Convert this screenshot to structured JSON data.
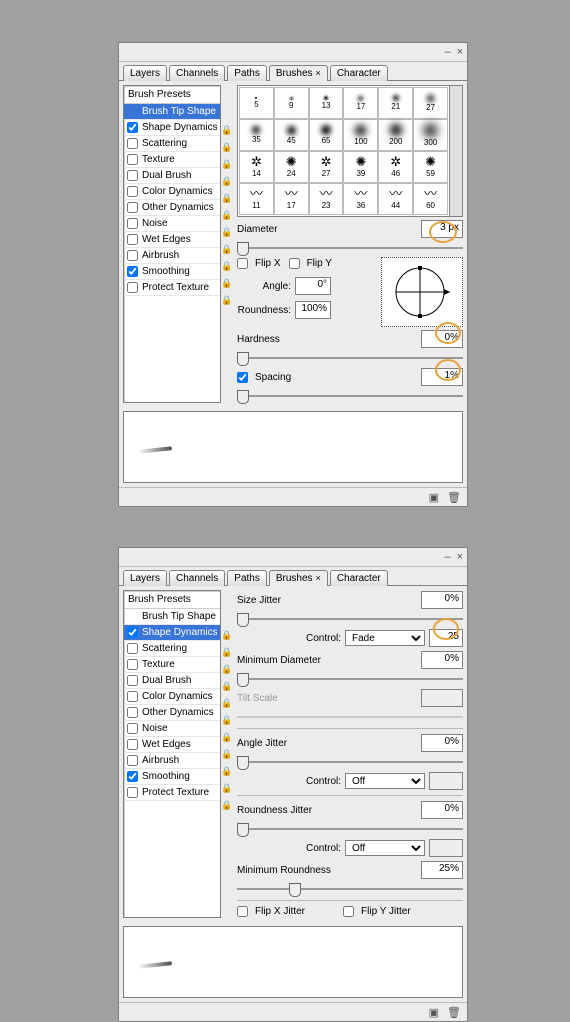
{
  "panel1": {
    "tabs": [
      "Layers",
      "Channels",
      "Paths",
      "Brushes",
      "Character"
    ],
    "activeTab": 3,
    "sidebarHeader": "Brush Presets",
    "sidebar": [
      {
        "label": "Brush Tip Shape",
        "hasCb": false,
        "checked": false,
        "selected": true
      },
      {
        "label": "Shape Dynamics",
        "hasCb": true,
        "checked": true,
        "lock": true
      },
      {
        "label": "Scattering",
        "hasCb": true,
        "checked": false,
        "lock": true
      },
      {
        "label": "Texture",
        "hasCb": true,
        "checked": false,
        "lock": true
      },
      {
        "label": "Dual Brush",
        "hasCb": true,
        "checked": false,
        "lock": true
      },
      {
        "label": "Color Dynamics",
        "hasCb": true,
        "checked": false,
        "lock": true
      },
      {
        "label": "Other Dynamics",
        "hasCb": true,
        "checked": false,
        "lock": true
      },
      {
        "label": "Noise",
        "hasCb": true,
        "checked": false,
        "lock": true
      },
      {
        "label": "Wet Edges",
        "hasCb": true,
        "checked": false,
        "lock": true
      },
      {
        "label": "Airbrush",
        "hasCb": true,
        "checked": false,
        "lock": true
      },
      {
        "label": "Smoothing",
        "hasCb": true,
        "checked": true,
        "lock": true
      },
      {
        "label": "Protect Texture",
        "hasCb": true,
        "checked": false,
        "lock": true
      }
    ],
    "brushes": [
      {
        "n": "5",
        "t": "dot",
        "d": 2,
        "b": 0
      },
      {
        "n": "9",
        "t": "dot",
        "d": 3,
        "b": 1
      },
      {
        "n": "13",
        "t": "dot",
        "d": 4,
        "b": 1
      },
      {
        "n": "17",
        "t": "dot",
        "d": 5,
        "b": 2
      },
      {
        "n": "21",
        "t": "dot",
        "d": 6,
        "b": 2
      },
      {
        "n": "27",
        "t": "dot",
        "d": 7,
        "b": 3
      },
      {
        "n": "35",
        "t": "dot",
        "d": 8,
        "b": 3
      },
      {
        "n": "45",
        "t": "dot",
        "d": 9,
        "b": 3
      },
      {
        "n": "65",
        "t": "dot",
        "d": 10,
        "b": 3
      },
      {
        "n": "100",
        "t": "dot",
        "d": 11,
        "b": 4
      },
      {
        "n": "200",
        "t": "dot",
        "d": 12,
        "b": 4
      },
      {
        "n": "300",
        "t": "dot",
        "d": 13,
        "b": 5
      },
      {
        "n": "14",
        "t": "splat",
        "g": "✲"
      },
      {
        "n": "24",
        "t": "splat",
        "g": "✺"
      },
      {
        "n": "27",
        "t": "splat",
        "g": "✲"
      },
      {
        "n": "39",
        "t": "splat",
        "g": "✺"
      },
      {
        "n": "46",
        "t": "splat",
        "g": "✲"
      },
      {
        "n": "59",
        "t": "splat",
        "g": "✺"
      },
      {
        "n": "11",
        "t": "splat",
        "g": "〰"
      },
      {
        "n": "17",
        "t": "splat",
        "g": "〰"
      },
      {
        "n": "23",
        "t": "splat",
        "g": "〰"
      },
      {
        "n": "36",
        "t": "splat",
        "g": "〰"
      },
      {
        "n": "44",
        "t": "splat",
        "g": "〰"
      },
      {
        "n": "60",
        "t": "splat",
        "g": "〰"
      }
    ],
    "labels": {
      "diameter": "Diameter",
      "diameterVal": "3 px",
      "flipX": "Flip X",
      "flipY": "Flip Y",
      "angle": "Angle:",
      "angleVal": "0°",
      "roundness": "Roundness:",
      "roundnessVal": "100%",
      "hardness": "Hardness",
      "hardnessVal": "0%",
      "spacing": "Spacing",
      "spacingVal": "1%"
    }
  },
  "panel2": {
    "tabs": [
      "Layers",
      "Channels",
      "Paths",
      "Brushes",
      "Character"
    ],
    "activeTab": 3,
    "sidebarHeader": "Brush Presets",
    "sidebar": [
      {
        "label": "Brush Tip Shape",
        "hasCb": false,
        "checked": false
      },
      {
        "label": "Shape Dynamics",
        "hasCb": true,
        "checked": true,
        "selected": true,
        "lock": true
      },
      {
        "label": "Scattering",
        "hasCb": true,
        "checked": false,
        "lock": true
      },
      {
        "label": "Texture",
        "hasCb": true,
        "checked": false,
        "lock": true
      },
      {
        "label": "Dual Brush",
        "hasCb": true,
        "checked": false,
        "lock": true
      },
      {
        "label": "Color Dynamics",
        "hasCb": true,
        "checked": false,
        "lock": true
      },
      {
        "label": "Other Dynamics",
        "hasCb": true,
        "checked": false,
        "lock": true
      },
      {
        "label": "Noise",
        "hasCb": true,
        "checked": false,
        "lock": true
      },
      {
        "label": "Wet Edges",
        "hasCb": true,
        "checked": false,
        "lock": true
      },
      {
        "label": "Airbrush",
        "hasCb": true,
        "checked": false,
        "lock": true
      },
      {
        "label": "Smoothing",
        "hasCb": true,
        "checked": true,
        "lock": true
      },
      {
        "label": "Protect Texture",
        "hasCb": true,
        "checked": false,
        "lock": true
      }
    ],
    "labels": {
      "sizeJitter": "Size Jitter",
      "sizeJitterVal": "0%",
      "control": "Control:",
      "sizeCtrl": "Fade",
      "sizeCtrlVal": "25",
      "minDiam": "Minimum Diameter",
      "minDiamVal": "0%",
      "tiltScale": "Tilt Scale",
      "angleJitter": "Angle Jitter",
      "angleJitterVal": "0%",
      "angleCtrl": "Off",
      "roundJitter": "Roundness Jitter",
      "roundJitterVal": "0%",
      "roundCtrl": "Off",
      "minRound": "Minimum Roundness",
      "minRoundVal": "25%",
      "flipXJ": "Flip X Jitter",
      "flipYJ": "Flip Y Jitter"
    }
  }
}
